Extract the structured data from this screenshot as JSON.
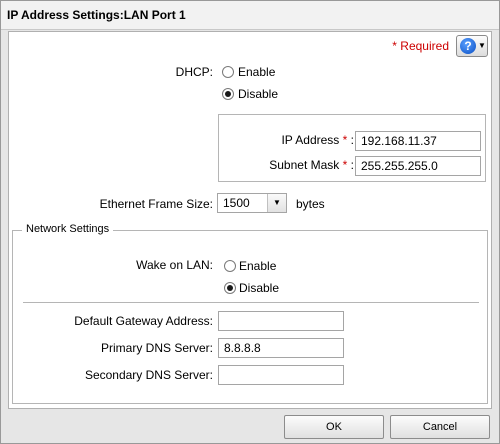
{
  "dialog": {
    "title": "IP Address Settings:LAN Port 1"
  },
  "required_label": "Required",
  "required_marker": "*",
  "help": {
    "icon": "question-icon",
    "symbol": "?"
  },
  "dhcp": {
    "label": "DHCP:",
    "options": [
      "Enable",
      "Disable"
    ],
    "selected": "Disable"
  },
  "ip": {
    "ip_label": "IP Address",
    "ip_value": "192.168.11.37",
    "mask_label": "Subnet Mask",
    "mask_value": "255.255.255.0",
    "colon": ":"
  },
  "frame": {
    "label": "Ethernet Frame Size:",
    "value": "1500",
    "unit": "bytes"
  },
  "network": {
    "legend": "Network Settings",
    "wol_label": "Wake on LAN:",
    "wol_options": [
      "Enable",
      "Disable"
    ],
    "wol_selected": "Disable",
    "gateway_label": "Default Gateway Address:",
    "gateway_value": "",
    "dns1_label": "Primary DNS Server:",
    "dns1_value": "8.8.8.8",
    "dns2_label": "Secondary DNS Server:",
    "dns2_value": ""
  },
  "buttons": {
    "ok": "OK",
    "cancel": "Cancel"
  },
  "colors": {
    "required": "#cc0000",
    "help_blue": "#0a4fc4"
  }
}
